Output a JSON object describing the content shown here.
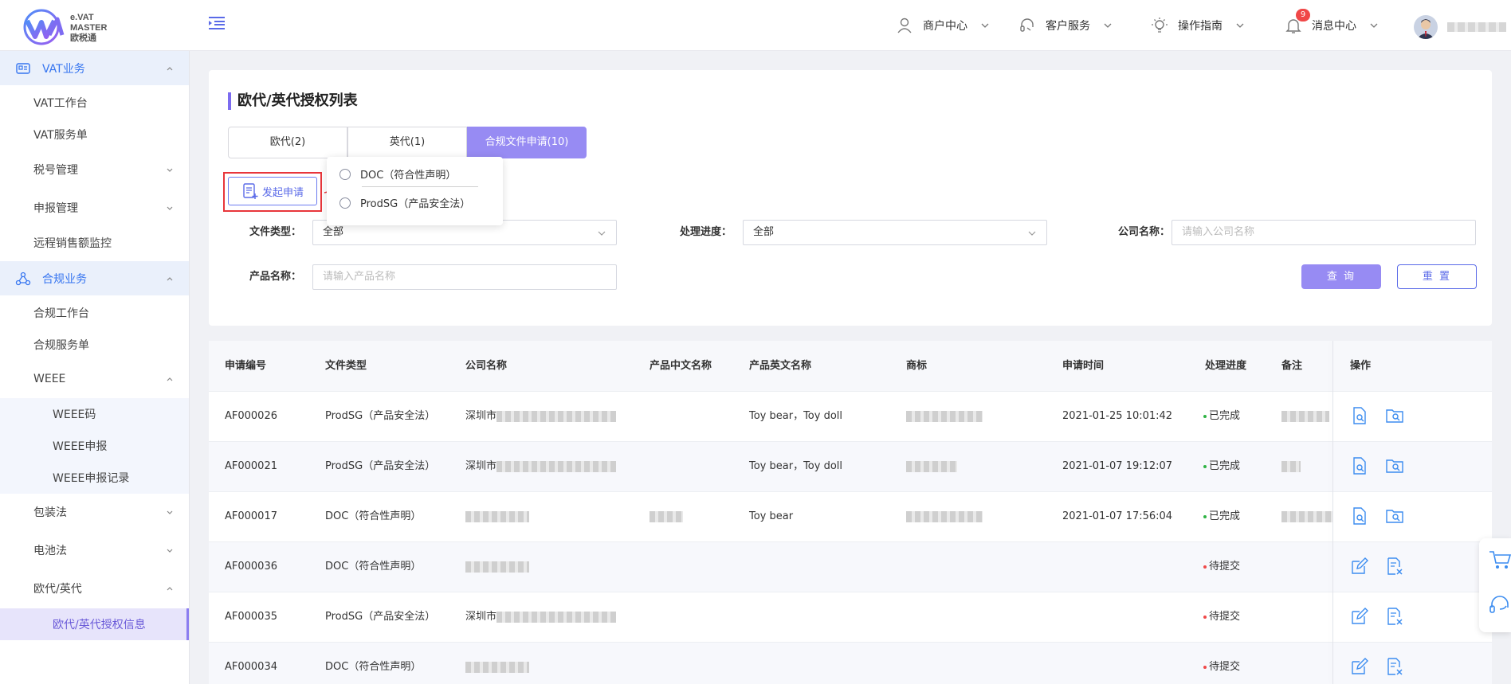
{
  "brand": {
    "line1": "e.VAT",
    "line2": "MASTER",
    "line3": "欧税通"
  },
  "header": {
    "merchant": "商户中心",
    "service": "客户服务",
    "guide": "操作指南",
    "messages": "消息中心",
    "message_count": "9",
    "username": ""
  },
  "sidebar": {
    "vat_group": "VAT业务",
    "vat_workbench": "VAT工作台",
    "vat_orders": "VAT服务单",
    "tax_mgmt": "税号管理",
    "declare_mgmt": "申报管理",
    "remote_sales": "远程销售额监控",
    "compliance_group": "合规业务",
    "compliance_workbench": "合规工作台",
    "compliance_orders": "合规服务单",
    "weee": "WEEE",
    "weee_code": "WEEE码",
    "weee_declare": "WEEE申报",
    "weee_records": "WEEE申报记录",
    "packaging": "包装法",
    "battery": "电池法",
    "rep": "欧代/英代",
    "rep_info": "欧代/英代授权信息"
  },
  "page": {
    "title": "欧代/英代授权列表",
    "tabs": [
      "欧代(2)",
      "英代(1)",
      "合规文件申请(10)"
    ],
    "apply_button": "发起申请",
    "popover_options": [
      "DOC（符合性声明）",
      "ProdSG（产品安全法）"
    ]
  },
  "filters": {
    "file_type_label": "文件类型：",
    "file_type_value": "全部",
    "progress_label": "处理进度：",
    "progress_value": "全部",
    "company_label": "公司名称：",
    "company_placeholder": "请输入公司名称",
    "product_label": "产品名称：",
    "product_placeholder": "请输入产品名称",
    "query": "查 询",
    "reset": "重 置"
  },
  "table": {
    "headers": [
      "申请编号",
      "文件类型",
      "公司名称",
      "产品中文名称",
      "产品英文名称",
      "商标",
      "申请时间",
      "处理进度",
      "备注",
      "操作"
    ],
    "rows": [
      {
        "id": "AF000026",
        "type": "ProdSG（产品安全法）",
        "company": "深圳市",
        "product_en": "Toy bear，Toy doll",
        "time": "2021-01-25 10:01:42",
        "status": "已完成"
      },
      {
        "id": "AF000021",
        "type": "ProdSG（产品安全法）",
        "company": "深圳市",
        "product_en": "Toy bear，Toy doll",
        "time": "2021-01-07 19:12:07",
        "status": "已完成"
      },
      {
        "id": "AF000017",
        "type": "DOC（符合性声明）",
        "company": "",
        "product_en": "Toy bear",
        "time": "2021-01-07 17:56:04",
        "status": "已完成"
      },
      {
        "id": "AF000036",
        "type": "DOC（符合性声明）",
        "company": "",
        "product_en": "",
        "time": "",
        "status": "待提交"
      },
      {
        "id": "AF000035",
        "type": "ProdSG（产品安全法）",
        "company": "深圳市",
        "product_en": "",
        "time": "",
        "status": "待提交"
      },
      {
        "id": "AF000034",
        "type": "DOC（符合性声明）",
        "company": "",
        "product_en": "",
        "time": "",
        "status": "待提交"
      }
    ]
  },
  "colors": {
    "accent": "#978bf3",
    "primary_blue": "#3574f0",
    "done": "#2fb344",
    "pending": "#f04848",
    "highlight": "#e8363b"
  },
  "icons": [
    "menu-collapse-icon",
    "user-icon",
    "headset-icon",
    "bulb-icon",
    "bell-icon",
    "cart-icon",
    "support-icon",
    "view-doc-icon",
    "folder-search-icon",
    "edit-icon",
    "delete-doc-icon"
  ]
}
